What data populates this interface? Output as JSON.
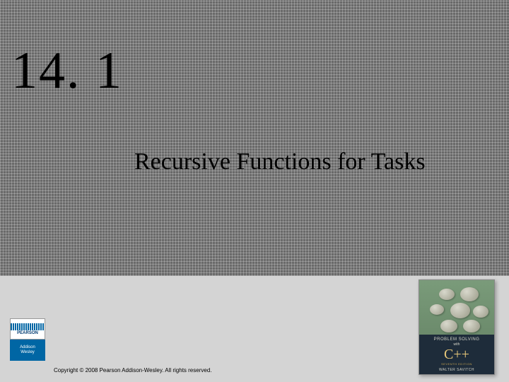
{
  "section": {
    "number": "14. 1",
    "title": "Recursive Functions for Tasks"
  },
  "publisher": {
    "name": "PEARSON",
    "imprint_line1": "Addison",
    "imprint_line2": "Wesley"
  },
  "book": {
    "title_line1": "PROBLEM SOLVING",
    "title_line2": "with",
    "language": "C++",
    "edition": "SEVENTH EDITION",
    "author": "WALTER SAVITCH"
  },
  "copyright": "Copyright © 2008 Pearson Addison-Wesley. All rights reserved."
}
